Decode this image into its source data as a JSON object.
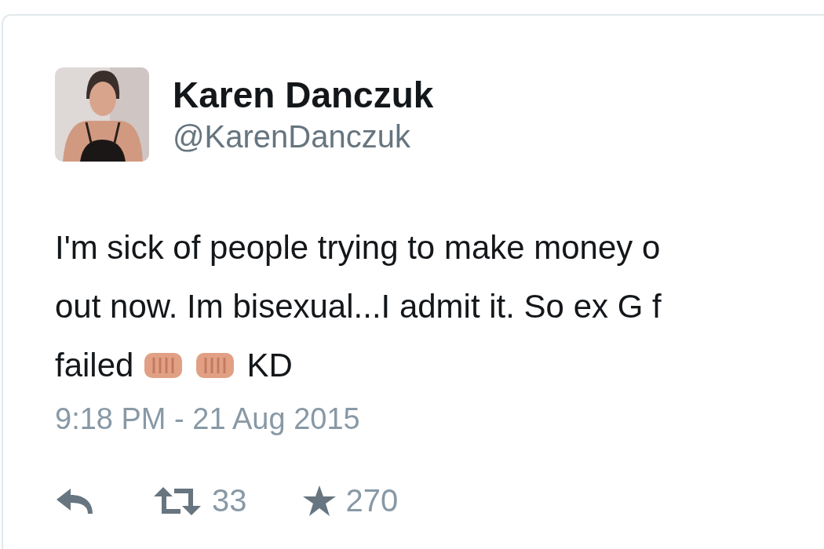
{
  "tweet": {
    "author": {
      "name": "Karen Danczuk",
      "handle": "@KarenDanczuk"
    },
    "body_lines": [
      {
        "segments": [
          {
            "kind": "text",
            "text": "I'm sick of people trying to make money o"
          }
        ]
      },
      {
        "segments": [
          {
            "kind": "text",
            "text": "out now. Im bisexual...I admit it. So ex G f"
          }
        ]
      },
      {
        "segments": [
          {
            "kind": "text",
            "text": "failed"
          },
          {
            "kind": "emoji"
          },
          {
            "kind": "emoji"
          },
          {
            "kind": "text",
            "text": "KD"
          }
        ]
      }
    ],
    "timestamp": "9:18 PM - 21 Aug 2015",
    "actions": [
      {
        "kind": "reply"
      },
      {
        "kind": "retweet",
        "count": "33"
      },
      {
        "kind": "favorite",
        "count": "270"
      }
    ]
  }
}
